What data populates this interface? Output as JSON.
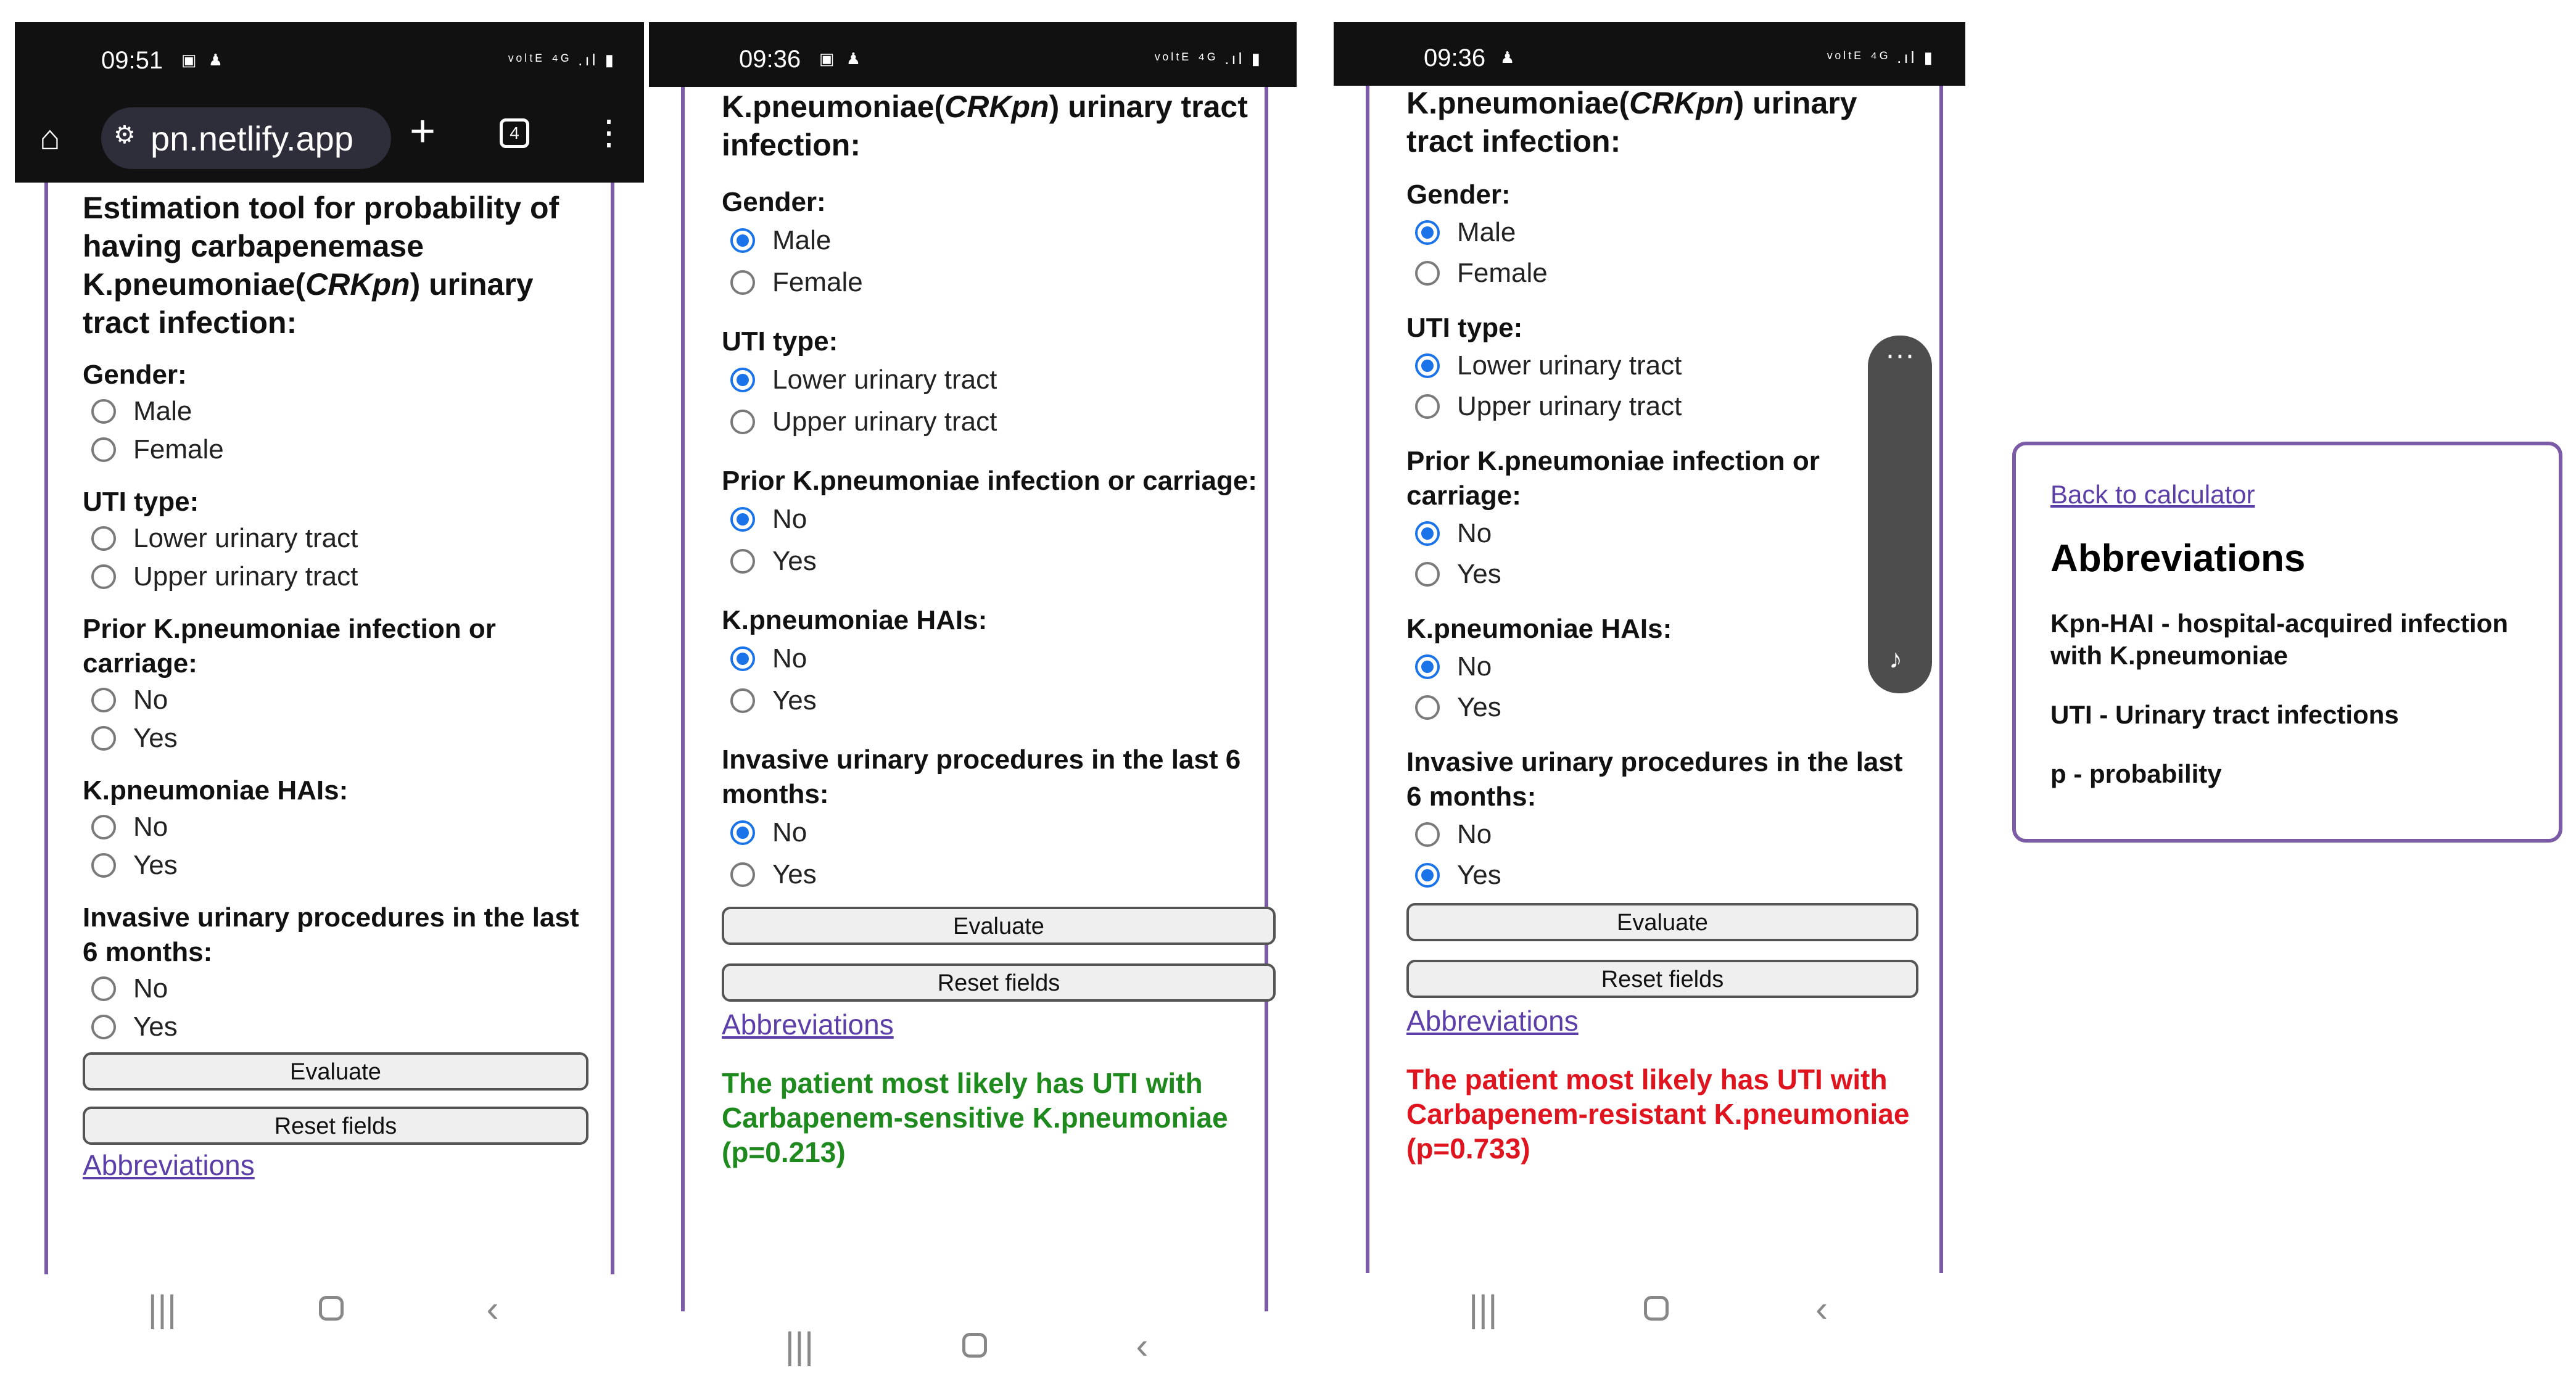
{
  "phone1": {
    "status": {
      "time": "09:51",
      "icons": "▣ ♟",
      "right": "ᵛᵒˡᵗᴱ ⁴ᴳ .ıl ▮"
    },
    "browser": {
      "url": "pn.netlify.app",
      "tabs": "4"
    },
    "title": "Estimation tool for probability of having carbapenemase K.pneumoniae(",
    "title_italic": "CRKpn",
    "title_end": ") urinary tract infection:",
    "questions": [
      {
        "label": "Gender:",
        "options": [
          {
            "text": "Male",
            "checked": false
          },
          {
            "text": "Female",
            "checked": false
          }
        ]
      },
      {
        "label": "UTI type:",
        "options": [
          {
            "text": "Lower urinary tract",
            "checked": false
          },
          {
            "text": "Upper urinary tract",
            "checked": false
          }
        ]
      },
      {
        "label": "Prior K.pneumoniae infection or carriage:",
        "options": [
          {
            "text": "No",
            "checked": false
          },
          {
            "text": "Yes",
            "checked": false
          }
        ]
      },
      {
        "label": "K.pneumoniae HAIs:",
        "options": [
          {
            "text": "No",
            "checked": false
          },
          {
            "text": "Yes",
            "checked": false
          }
        ]
      },
      {
        "label": "Invasive urinary procedures in the last 6 months:",
        "options": [
          {
            "text": "No",
            "checked": false
          },
          {
            "text": "Yes",
            "checked": false
          }
        ]
      }
    ],
    "evaluate": "Evaluate",
    "reset": "Reset fields",
    "abbr_link": "Abbreviations"
  },
  "phone2": {
    "status": {
      "time": "09:36",
      "icons": "▣ ♟",
      "right": "ᵛᵒˡᵗᴱ ⁴ᴳ .ıl ▮"
    },
    "title": "K.pneumoniae(",
    "title_italic": "CRKpn",
    "title_end": ") urinary tract infection:",
    "questions": [
      {
        "label": "Gender:",
        "options": [
          {
            "text": "Male",
            "checked": true
          },
          {
            "text": "Female",
            "checked": false
          }
        ]
      },
      {
        "label": "UTI type:",
        "options": [
          {
            "text": "Lower urinary tract",
            "checked": true
          },
          {
            "text": "Upper urinary tract",
            "checked": false
          }
        ]
      },
      {
        "label": "Prior K.pneumoniae infection or carriage:",
        "options": [
          {
            "text": "No",
            "checked": true
          },
          {
            "text": "Yes",
            "checked": false
          }
        ]
      },
      {
        "label": "K.pneumoniae HAIs:",
        "options": [
          {
            "text": "No",
            "checked": true
          },
          {
            "text": "Yes",
            "checked": false
          }
        ]
      },
      {
        "label": "Invasive urinary procedures in the last 6 months:",
        "options": [
          {
            "text": "No",
            "checked": true
          },
          {
            "text": "Yes",
            "checked": false
          }
        ]
      }
    ],
    "evaluate": "Evaluate",
    "reset": "Reset fields",
    "abbr_link": "Abbreviations",
    "result": "The patient most likely has UTI with Carbapenem-sensitive K.pneumoniae (p=0.213)",
    "result_color": "#1e8a1e"
  },
  "phone3": {
    "status": {
      "time": "09:36",
      "icons": "♟",
      "right": "ᵛᵒˡᵗᴱ ⁴ᴳ .ıl ▮"
    },
    "title": "K.pneumoniae(",
    "title_italic": "CRKpn",
    "title_end": ") urinary tract infection:",
    "questions": [
      {
        "label": "Gender:",
        "options": [
          {
            "text": "Male",
            "checked": true
          },
          {
            "text": "Female",
            "checked": false
          }
        ]
      },
      {
        "label": "UTI type:",
        "options": [
          {
            "text": "Lower urinary tract",
            "checked": true
          },
          {
            "text": "Upper urinary tract",
            "checked": false
          }
        ]
      },
      {
        "label": "Prior K.pneumoniae infection or carriage:",
        "options": [
          {
            "text": "No",
            "checked": true
          },
          {
            "text": "Yes",
            "checked": false
          }
        ]
      },
      {
        "label": "K.pneumoniae HAIs:",
        "options": [
          {
            "text": "No",
            "checked": true
          },
          {
            "text": "Yes",
            "checked": false
          }
        ]
      },
      {
        "label": "Invasive urinary procedures in the last 6 months:",
        "options": [
          {
            "text": "No",
            "checked": false
          },
          {
            "text": "Yes",
            "checked": true
          }
        ]
      }
    ],
    "evaluate": "Evaluate",
    "reset": "Reset fields",
    "abbr_link": "Abbreviations",
    "result": "The patient most likely has UTI with Carbapenem-resistant K.pneumoniae (p=0.733)",
    "result_color": "#e0141e"
  },
  "abbreviations_page": {
    "back_link": "Back to calculator",
    "heading": "Abbreviations",
    "items": [
      "Kpn-HAI - hospital-acquired infection with K.pneumoniae",
      "UTI - Urinary tract infections",
      "p - probability"
    ]
  },
  "colors": {
    "accent": "#7b5aa6",
    "link": "#5b3ea8",
    "radio_checked": "#1a73e8"
  },
  "icons": {
    "home": "home-icon",
    "add_tab": "plus-icon",
    "tab_count": "tab-switcher-icon",
    "menu": "kebab-menu-icon"
  }
}
